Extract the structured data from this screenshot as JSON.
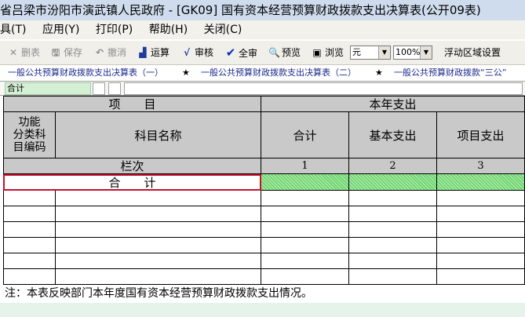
{
  "window": {
    "title": "省吕梁市汾阳市演武镇人民政府 - [GK09] 国有资本经营预算财政拨款支出决算表(公开09表)"
  },
  "menu": [
    "具(T)",
    "应用(Y)",
    "打印(P)",
    "帮助(H)",
    "关闭(C)"
  ],
  "toolbar": {
    "delete": "删表",
    "save": "保存",
    "undo": "撤消",
    "calc": "运算",
    "audit": "审核",
    "audit_all": "全审",
    "preview": "预览",
    "browse": "浏览",
    "unit_value": "元",
    "zoom_value": "100%",
    "float_area": "浮动区域设置"
  },
  "tabs": [
    "一般公共预算财政拨款支出决算表（一）",
    "一般公共预算财政拨款支出决算表（二）",
    "一般公共预算财政拨款“三公”"
  ],
  "star": "★",
  "formula": {
    "cell_name": "合计"
  },
  "table": {
    "header_item": "项　　目",
    "header_year": "本年支出",
    "col_code": "功能\n分类科\n目编码",
    "col_name": "科目名称",
    "col_total": "合计",
    "col_basic": "基本支出",
    "col_project": "项目支出",
    "row_index_label": "栏次",
    "index_1": "1",
    "index_2": "2",
    "index_3": "3",
    "total_label": "合　　计",
    "note": "注：本表反映部门本年度国有资本经营预算财政拨款支出情况。"
  },
  "colors": {
    "accent_green": "#6fd66f",
    "header_gray": "#c9c9c9",
    "titlebar": "#cfdcee"
  }
}
